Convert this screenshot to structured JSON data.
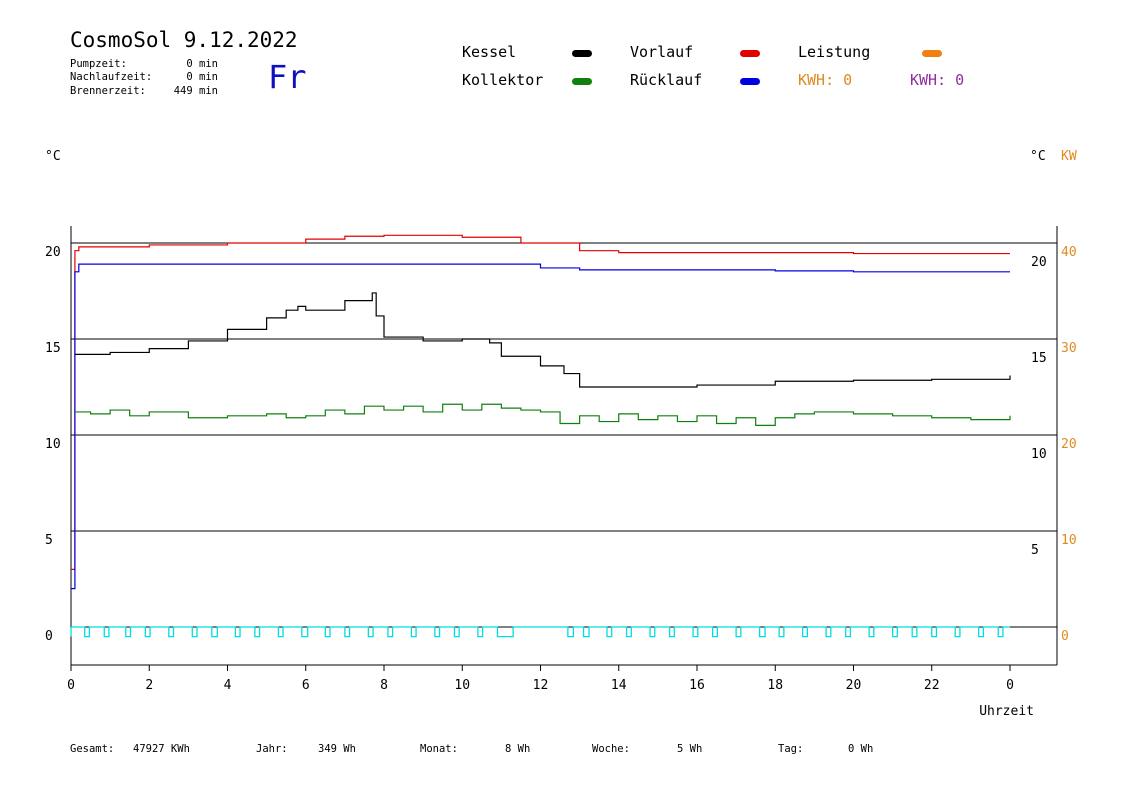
{
  "header": {
    "title": "CosmoSol 9.12.2022",
    "weekday": "Fr",
    "stats": [
      {
        "label": "Pumpzeit:",
        "value": "0 min"
      },
      {
        "label": "Nachlaufzeit:",
        "value": "0 min"
      },
      {
        "label": "Brennerzeit:",
        "value": "449 min"
      }
    ]
  },
  "legend": {
    "kessel": {
      "label": "Kessel",
      "color": "#000000"
    },
    "vorlauf": {
      "label": "Vorlauf",
      "color": "#e00000"
    },
    "leistung": {
      "label": "Leistung",
      "color": "#f08010"
    },
    "kollektor": {
      "label": "Kollektor",
      "color": "#108010"
    },
    "ruecklauf": {
      "label": "Rücklauf",
      "color": "#0000e0"
    },
    "kwh_orange": "KWH: 0",
    "kwh_purple": "KWH: 0",
    "kwh_orange_color": "#e08a20",
    "kwh_purple_color": "#9030a0"
  },
  "units": {
    "left": "°C",
    "right_c": "°C",
    "right_kw": "KW"
  },
  "footer": {
    "gesamt_label": "Gesamt:",
    "gesamt_value": "47927 KWh",
    "jahr_label": "Jahr:",
    "jahr_value": "349 Wh",
    "monat_label": "Monat:",
    "monat_value": "8 Wh",
    "woche_label": "Woche:",
    "woche_value": "5 Wh",
    "tag_label": "Tag:",
    "tag_value": "0 Wh"
  },
  "chart_data": {
    "type": "line",
    "xlabel": "Uhrzeit",
    "x_ticks": [
      "0",
      "2",
      "4",
      "6",
      "8",
      "10",
      "12",
      "14",
      "16",
      "18",
      "20",
      "22",
      "0"
    ],
    "xlim": [
      0,
      24
    ],
    "ylim": [
      0,
      20
    ],
    "y_ticks_left": [
      "0",
      "5",
      "10",
      "15",
      "20"
    ],
    "y_ticks_right_c": [
      "5",
      "10",
      "15",
      "20"
    ],
    "y_ticks_right_kw": [
      "0",
      "10",
      "20",
      "30",
      "40"
    ],
    "grid": "horizontal",
    "series": [
      {
        "name": "Vorlauf",
        "color": "#e00000",
        "x": [
          0,
          0.1,
          0.2,
          2,
          4,
          6,
          7,
          8,
          10,
          11.5,
          13,
          14,
          16,
          18,
          20,
          22,
          24
        ],
        "y": [
          3,
          19.6,
          19.8,
          19.9,
          20.0,
          20.2,
          20.35,
          20.4,
          20.3,
          20.0,
          19.6,
          19.5,
          19.5,
          19.5,
          19.45,
          19.45,
          19.45
        ]
      },
      {
        "name": "Rücklauf",
        "color": "#0000e0",
        "x": [
          0,
          0.1,
          0.2,
          2,
          4,
          6,
          8,
          10,
          11.5,
          12,
          13,
          14,
          16,
          18,
          20,
          22,
          24
        ],
        "y": [
          2,
          18.5,
          18.9,
          18.9,
          18.9,
          18.9,
          18.9,
          18.9,
          18.9,
          18.7,
          18.6,
          18.6,
          18.6,
          18.55,
          18.5,
          18.5,
          18.5
        ]
      },
      {
        "name": "Kessel",
        "color": "#000000",
        "x": [
          0.1,
          1,
          2,
          3,
          4,
          5,
          5.5,
          5.8,
          6,
          7,
          7.7,
          7.8,
          8,
          9,
          10,
          10.7,
          11,
          12,
          12.6,
          13,
          14,
          16,
          18,
          20,
          22,
          24
        ],
        "y": [
          14.2,
          14.3,
          14.5,
          14.9,
          15.5,
          16.1,
          16.5,
          16.7,
          16.5,
          17.0,
          17.4,
          16.2,
          15.1,
          14.9,
          15.0,
          14.8,
          14.1,
          13.6,
          13.2,
          12.5,
          12.5,
          12.6,
          12.8,
          12.85,
          12.9,
          13.1
        ]
      },
      {
        "name": "Kollektor",
        "color": "#108010",
        "x": [
          0.1,
          0.5,
          1,
          1.5,
          2,
          3,
          4,
          5,
          5.5,
          6,
          6.5,
          7,
          7.5,
          8,
          8.5,
          9,
          9.5,
          10,
          10.5,
          11,
          11.5,
          12,
          12.5,
          13,
          13.5,
          14,
          14.5,
          15,
          15.5,
          16,
          16.5,
          17,
          17.5,
          18,
          18.5,
          19,
          20,
          21,
          22,
          23,
          24
        ],
        "y": [
          11.2,
          11.1,
          11.3,
          11.0,
          11.2,
          10.9,
          11.0,
          11.1,
          10.9,
          11.0,
          11.3,
          11.1,
          11.5,
          11.3,
          11.5,
          11.2,
          11.6,
          11.3,
          11.6,
          11.4,
          11.3,
          11.2,
          10.6,
          11.0,
          10.7,
          11.1,
          10.8,
          11.0,
          10.7,
          11.0,
          10.6,
          10.9,
          10.5,
          10.9,
          11.1,
          11.2,
          11.1,
          11.0,
          10.9,
          10.8,
          11.0
        ]
      }
    ],
    "pulse_series": {
      "name": "Pumpe",
      "color": "#00dede",
      "start": [
        0.35,
        0.85,
        1.4,
        1.9,
        2.5,
        3.1,
        3.6,
        4.2,
        4.7,
        5.3,
        5.9,
        6.5,
        7.0,
        7.6,
        8.1,
        8.7,
        9.3,
        9.8,
        10.4,
        10.9,
        12.7,
        13.1,
        13.7,
        14.2,
        14.8,
        15.3,
        15.9,
        16.4,
        17.0,
        17.6,
        18.1,
        18.7,
        19.3,
        19.8,
        20.4,
        21.0,
        21.5,
        22.0,
        22.6,
        23.2,
        23.7
      ],
      "width": [
        0.12,
        0.12,
        0.12,
        0.12,
        0.12,
        0.12,
        0.14,
        0.12,
        0.12,
        0.12,
        0.15,
        0.12,
        0.12,
        0.12,
        0.12,
        0.12,
        0.12,
        0.12,
        0.12,
        0.4,
        0.14,
        0.14,
        0.12,
        0.12,
        0.12,
        0.12,
        0.12,
        0.12,
        0.12,
        0.14,
        0.12,
        0.12,
        0.12,
        0.12,
        0.12,
        0.12,
        0.12,
        0.12,
        0.12,
        0.12,
        0.12
      ],
      "high": 0,
      "low": -0.5
    }
  }
}
